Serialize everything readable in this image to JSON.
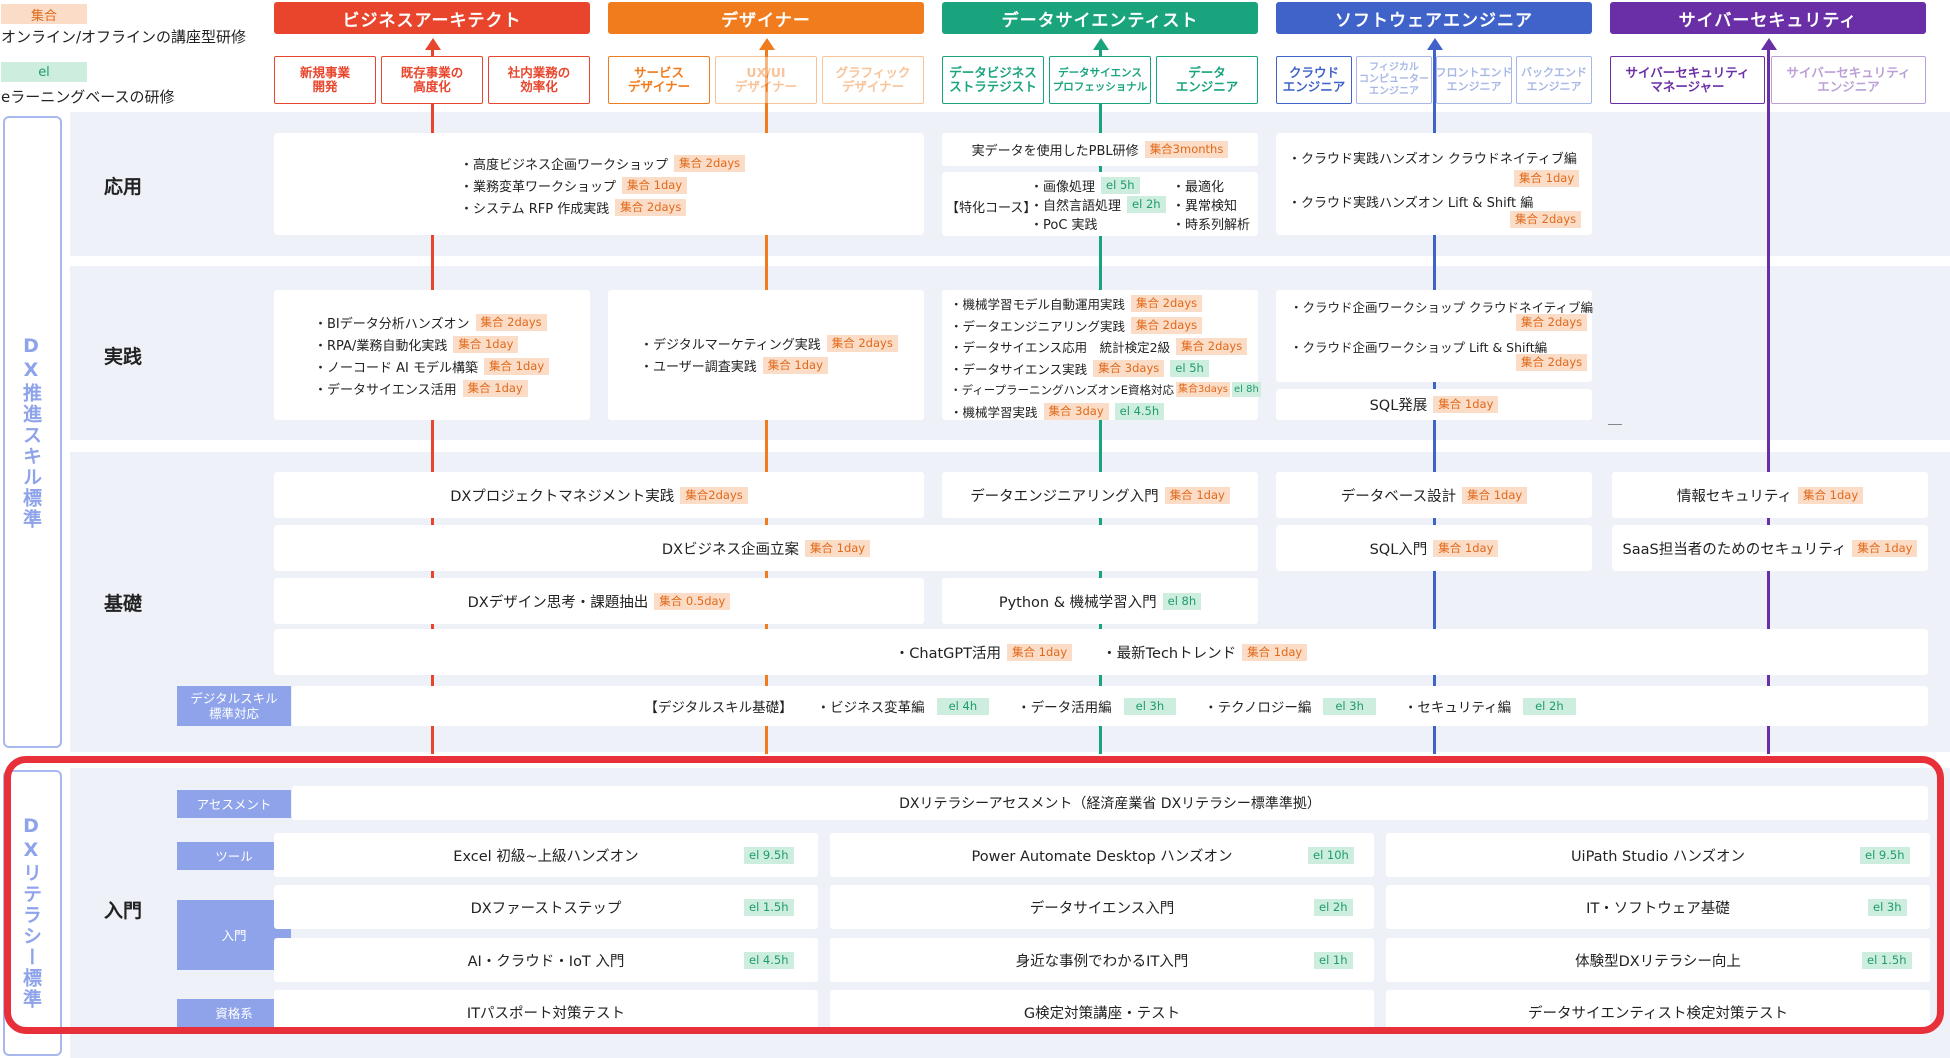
{
  "legend": {
    "group_tag": "集合",
    "group_text": "オンライン/オフラインの講座型研修",
    "el_tag": "el",
    "el_text": "eラーニングベースの研修"
  },
  "colors": {
    "red": "#e8452c",
    "orange": "#f07c1e",
    "green": "#19a47d",
    "blue": "#3f63c9",
    "purple": "#6a2fa6",
    "band": "#eef1f7",
    "sidetag": "#8ea3ea",
    "highlight": "#e8303a"
  },
  "roles": [
    {
      "name": "ビジネスアーキテクト",
      "subs": [
        "新規事業\n開発",
        "既存事業の\n高度化",
        "社内業務の\n効率化"
      ]
    },
    {
      "name": "デザイナー",
      "subs": [
        "サービス\nデザイナー",
        "UX/UI\nデザイナー",
        "グラフィック\nデザイナー"
      ]
    },
    {
      "name": "データサイエンティスト",
      "subs": [
        "データビジネス\nストラテジスト",
        "データサイエンス\nプロフェッショナル",
        "データ\nエンジニア"
      ]
    },
    {
      "name": "ソフトウェアエンジニア",
      "subs": [
        "クラウド\nエンジニア",
        "フィジカル\nコンピューター\nエンジニア",
        "フロントエンド\nエンジニア",
        "バックエンド\nエンジニア"
      ]
    },
    {
      "name": "サイバーセキュリティ",
      "subs": [
        "サイバーセキュリティ\nマネージャー",
        "サイバーセキュリティ\nエンジニア"
      ]
    }
  ],
  "levels": {
    "applied": "応用",
    "practice": "実践",
    "basic": "基礎",
    "intro": "入門"
  },
  "vertical": {
    "dx_skill": "DX推進スキル標準",
    "dx_literacy": "DXリテラシー標準"
  },
  "applied": {
    "biz": [
      {
        "t": "・高度ビジネス企画ワークショップ",
        "g": "集合 2days"
      },
      {
        "t": "・業務変革ワークショップ",
        "g": "集合 1day"
      },
      {
        "t": "・システム RFP 作成実践",
        "g": "集合 2days"
      }
    ],
    "ds_top": {
      "t": "実データを使用したPBL研修",
      "g": "集合3months"
    },
    "ds_course_label": "【特化コース】",
    "ds_mid": [
      {
        "t": "・画像処理",
        "e": "el 5h"
      },
      {
        "t": "・自然言語処理",
        "e": "el 2h"
      },
      {
        "t": "・PoC 実践"
      }
    ],
    "ds_right": [
      "・最適化",
      "・異常検知",
      "・時系列解析"
    ],
    "sw": [
      {
        "t": "・クラウド実践ハンズオン クラウドネイティブ編",
        "g": "集合 1day"
      },
      {
        "t": "・クラウド実践ハンズオン Lift & Shift 編",
        "g": "集合 2days"
      }
    ]
  },
  "practice": {
    "biz": [
      {
        "t": "・BIデータ分析ハンズオン",
        "g": "集合 2days"
      },
      {
        "t": "・RPA/業務自動化実践",
        "g": "集合 1day"
      },
      {
        "t": "・ノーコード AI モデル構築",
        "g": "集合 1day"
      },
      {
        "t": "・データサイエンス活用",
        "g": "集合 1day"
      }
    ],
    "des": [
      {
        "t": "・デジタルマーケティング実践",
        "g": "集合 2days"
      },
      {
        "t": "・ユーザー調査実践",
        "g": "集合 1day"
      }
    ],
    "ds": [
      {
        "t": "・機械学習モデル自動運用実践",
        "g": "集合 2days"
      },
      {
        "t": "・データエンジニアリング実践",
        "g": "集合 2days"
      },
      {
        "t": "・データサイエンス応用　統計検定2級",
        "g": "集合 2days"
      },
      {
        "t": "・データサイエンス実践",
        "g": "集合 3days",
        "e": "el 5h"
      },
      {
        "t": "・ディープラーニングハンズオンE資格対応",
        "g": "集合3days",
        "e": "el 8h"
      },
      {
        "t": "・機械学習実践",
        "g": "集合 3day",
        "e": "el 4.5h"
      }
    ],
    "sw": [
      {
        "t": "・クラウド企画ワークショップ クラウドネイティブ編",
        "g": "集合 2days"
      },
      {
        "t": "・クラウド企画ワークショップ Lift & Shift編",
        "g": "集合 2days"
      }
    ],
    "sql": {
      "t": "SQL発展",
      "g": "集合 1day"
    }
  },
  "basic": {
    "pm": {
      "t": "DXプロジェクトマネジメント実践",
      "g": "集合2days"
    },
    "de": {
      "t": "データエンジニアリング入門",
      "g": "集合 1day"
    },
    "db": {
      "t": "データベース設計",
      "g": "集合 1day"
    },
    "sec": {
      "t": "情報セキュリティ",
      "g": "集合 1day"
    },
    "plan": {
      "t": "DXビジネス企画立案",
      "g": "集合 1day"
    },
    "sqlin": {
      "t": "SQL入門",
      "g": "集合 1day"
    },
    "saas": {
      "t": "SaaS担当者のためのセキュリティ",
      "g": "集合 1day"
    },
    "design": {
      "t": "DXデザイン思考・課題抽出",
      "g": "集合 0.5day"
    },
    "py": {
      "t": "Python & 機械学習入門",
      "e": "el 8h"
    },
    "gpt": {
      "t": "・ChatGPT活用",
      "g": "集合 1day"
    },
    "trend": {
      "t": "・最新Techトレンド",
      "g": "集合 1day"
    },
    "digital_label": "デジタルスキル\n標準対応",
    "digital_title": "【デジタルスキル基礎】",
    "digital": [
      {
        "t": "・ビジネス変革編",
        "e": "el 4h"
      },
      {
        "t": "・データ活用編",
        "e": "el 3h"
      },
      {
        "t": "・テクノロジー編",
        "e": "el 3h"
      },
      {
        "t": "・セキュリティ編",
        "e": "el 2h"
      }
    ]
  },
  "intro": {
    "labels": {
      "assess": "アセスメント",
      "tool": "ツール",
      "intro": "入門",
      "cert": "資格系"
    },
    "assess": "DXリテラシーアセスメント（経済産業省 DXリテラシー標準準拠）",
    "tools": [
      {
        "t": "Excel 初級~上級ハンズオン",
        "e": "el 9.5h"
      },
      {
        "t": "Power Automate Desktop ハンズオン",
        "e": "el 10h"
      },
      {
        "t": "UiPath Studio ハンズオン",
        "e": "el 9.5h"
      }
    ],
    "intro1": [
      {
        "t": "DXファーストステップ",
        "e": "el 1.5h"
      },
      {
        "t": "データサイエンス入門",
        "e": "el 2h"
      },
      {
        "t": "IT・ソフトウェア基礎",
        "e": "el 3h"
      }
    ],
    "intro2": [
      {
        "t": "AI・クラウド・IoT 入門",
        "e": "el 4.5h"
      },
      {
        "t": "身近な事例でわかるIT入門",
        "e": "el 1h"
      },
      {
        "t": "体験型DXリテラシー向上",
        "e": "el 1.5h"
      }
    ],
    "cert": [
      "ITパスポート対策テスト",
      "G検定対策講座・テスト",
      "データサイエンティスト検定対策テスト"
    ]
  }
}
